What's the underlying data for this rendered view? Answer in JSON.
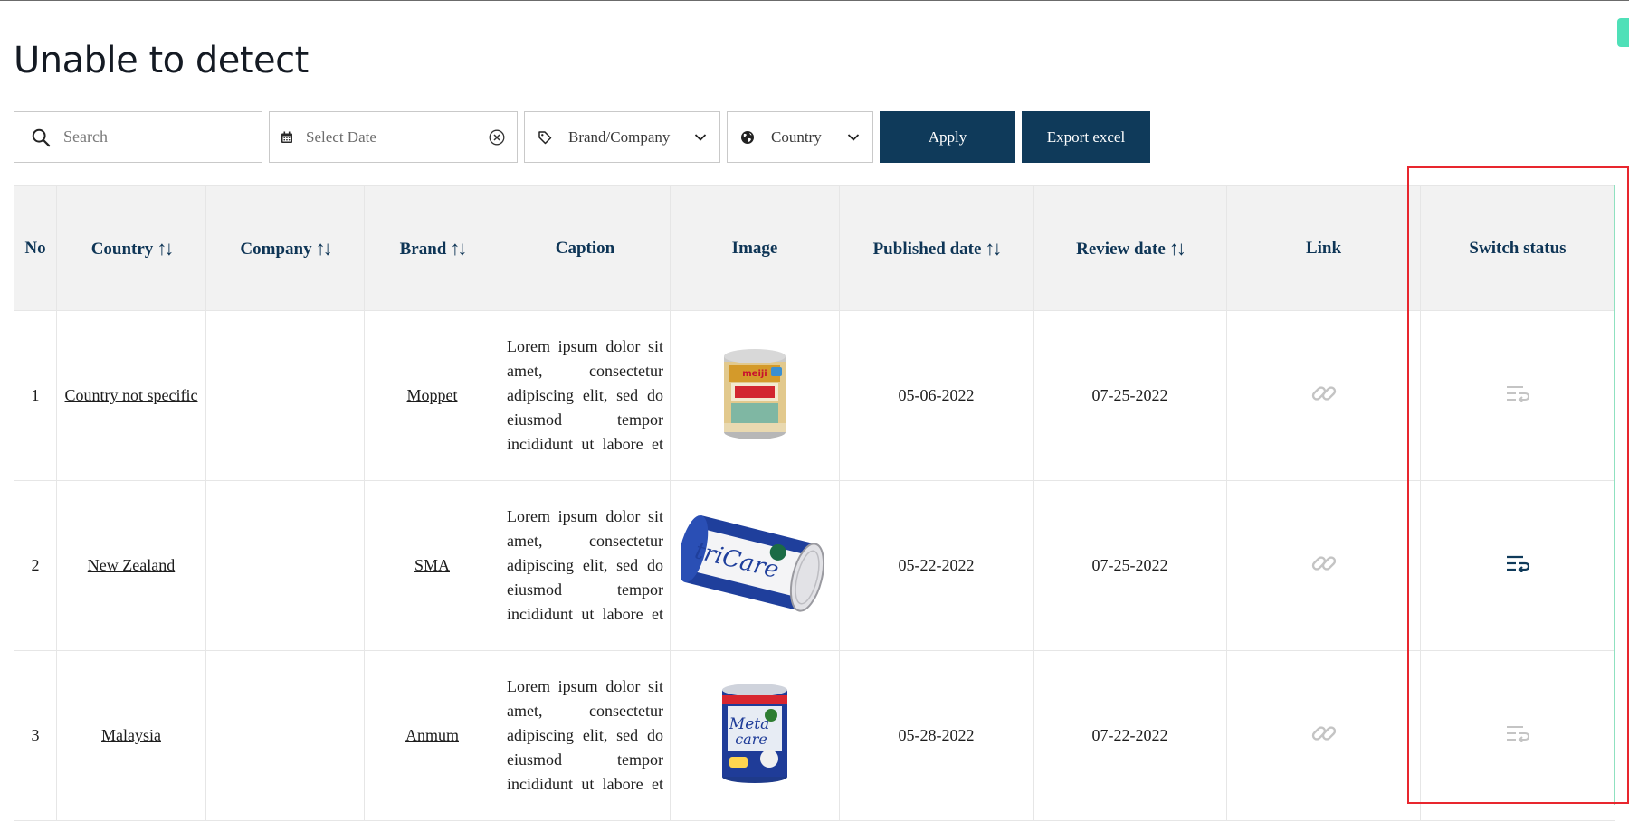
{
  "page": {
    "title": "Unable to detect"
  },
  "toolbar": {
    "search_placeholder": "Search",
    "date_placeholder": "Select Date",
    "brand_label": "Brand/Company",
    "country_label": "Country",
    "apply_label": "Apply",
    "export_label": "Export excel"
  },
  "table": {
    "headers": {
      "no": "No",
      "country": "Country",
      "company": "Company",
      "brand": "Brand",
      "caption": "Caption",
      "image": "Image",
      "published": "Published date",
      "review": "Review date",
      "link": "Link",
      "switch": "Switch status"
    },
    "sort_icon": "↑↓",
    "rows": [
      {
        "no": "1",
        "country": "Country not specific",
        "company": "",
        "brand": "Moppet",
        "caption": "Lorem ipsum dolor sit amet, consectetur adipiscing elit, sed do eiusmod tempor incididunt ut labore et dolore ma…",
        "image": "meiji-can-icon",
        "published": "05-06-2022",
        "review": "07-25-2022",
        "switch_active": false
      },
      {
        "no": "2",
        "country": "New Zealand",
        "company": "",
        "brand": "SMA",
        "caption": "Lorem ipsum dolor sit amet, consectetur adipiscing elit, sed do eiusmod tempor incididunt ut labore et dolore ma…",
        "image": "nutricare-can-icon",
        "published": "05-22-2022",
        "review": "07-25-2022",
        "switch_active": true
      },
      {
        "no": "3",
        "country": "Malaysia",
        "company": "",
        "brand": "Anmum",
        "caption": "Lorem ipsum dolor sit amet, consectetur adipiscing elit, sed do eiusmod tempor incididunt ut labore et dolore ma…",
        "image": "metacare-can-icon",
        "published": "05-28-2022",
        "review": "07-22-2022",
        "switch_active": false
      }
    ]
  },
  "colors": {
    "primary": "#0f3a5a",
    "header_bg": "#f2f2f2",
    "highlight": "#e8262e",
    "icon_inactive": "#c4c4c4"
  }
}
